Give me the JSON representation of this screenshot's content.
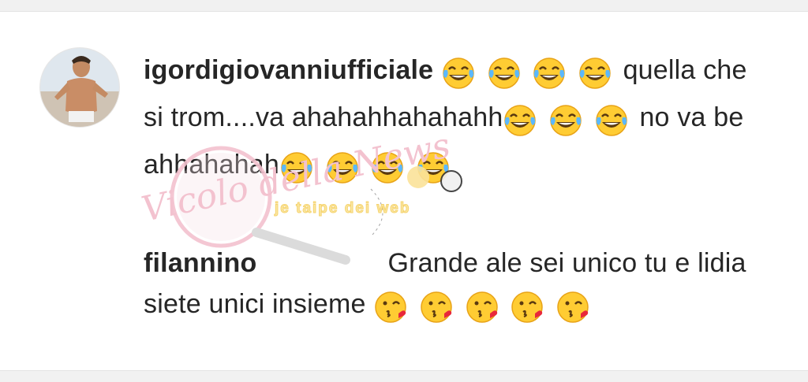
{
  "comments": [
    {
      "username": "igordigiovanniufficiale",
      "avatar_icon": "profile-photo-icon",
      "parts": {
        "lead_emojis": [
          "face-with-tears-of-joy",
          "face-with-tears-of-joy",
          "face-with-tears-of-joy",
          "face-with-tears-of-joy"
        ],
        "text1": "quella che si trom....va ahahahhahahahh",
        "mid_emojis": [
          "face-with-tears-of-joy",
          "face-with-tears-of-joy",
          "face-with-tears-of-joy"
        ],
        "text2": "no va be ahhahahah",
        "end_emojis": [
          "face-with-tears-of-joy",
          "face-with-tears-of-joy",
          "face-with-tears-of-joy",
          "face-with-tears-of-joy"
        ]
      }
    },
    {
      "username": "filannino",
      "text": "Grande ale sei unico tu e lidia siete unici insieme",
      "end_emojis": [
        "face-blowing-kiss",
        "face-blowing-kiss",
        "face-blowing-kiss",
        "face-blowing-kiss",
        "face-blowing-kiss"
      ]
    }
  ],
  "watermark": {
    "brand": "Vicolo della News",
    "tagline": "je taipe dei web"
  },
  "colors": {
    "text": "#262626",
    "emoji_yellow": "#ffcc33",
    "emoji_outline": "#e8a317",
    "tear_blue": "#5bb8ff",
    "kiss_heart": "#e8283b",
    "watermark_pink": "#f3c2cf",
    "watermark_yellow": "#fbe7a3"
  }
}
